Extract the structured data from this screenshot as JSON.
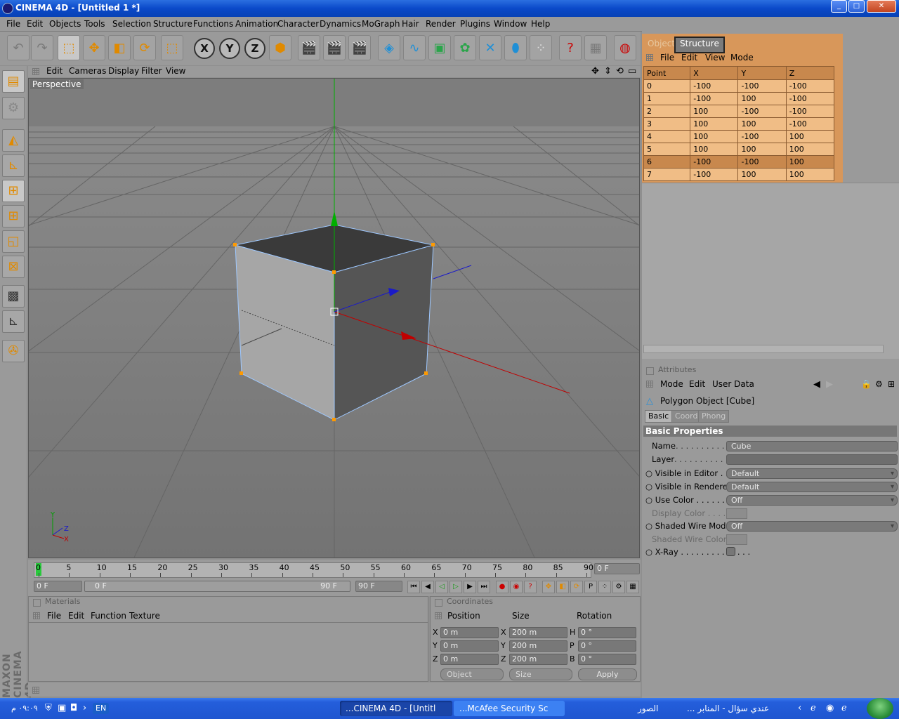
{
  "window": {
    "title": "CINEMA 4D - [Untitled 1 *]",
    "min_glyph": "_",
    "max_glyph": "□",
    "close_glyph": "✕"
  },
  "menubar": [
    "File",
    "Edit",
    "Objects",
    "Tools",
    "Selection",
    "Structure",
    "Functions",
    "Animation",
    "Character",
    "Dynamics",
    "MoGraph",
    "Hair",
    "Render",
    "Plugins",
    "Window",
    "Help"
  ],
  "toolbar_icons": [
    "undo-icon",
    "redo-icon",
    "live-selection-icon",
    "move-icon",
    "scale-icon",
    "rotate-icon",
    "selection-tool-icon",
    "x-axis-icon",
    "y-axis-icon",
    "z-axis-icon",
    "world-coordinates-icon",
    "render-view-icon",
    "render-picture-viewer-icon",
    "render-settings-icon",
    "cube-icon",
    "spline-icon",
    "nurbs-icon",
    "modeling-icon",
    "deformer-icon",
    "scene-icon",
    "particles-icon",
    "help-icon",
    "layout-icon",
    "web-icon"
  ],
  "xyz": {
    "x": "X",
    "y": "Y",
    "z": "Z"
  },
  "viewport": {
    "menu": [
      "Edit",
      "Cameras",
      "Display",
      "Filter",
      "View"
    ],
    "label": "Perspective"
  },
  "timeline": {
    "ticks": [
      "0",
      "5",
      "10",
      "15",
      "20",
      "25",
      "30",
      "35",
      "40",
      "45",
      "50",
      "55",
      "60",
      "65",
      "70",
      "75",
      "80",
      "85",
      "90"
    ],
    "current_frame": "0 F",
    "start_frame": "0 F",
    "range_start": "0 F",
    "range_end": "90 F",
    "end_frame": "90 F"
  },
  "materials": {
    "title": "Materials",
    "menu": [
      "File",
      "Edit",
      "Function",
      "Texture"
    ]
  },
  "coordinates": {
    "title": "Coordinates",
    "headers": [
      "Position",
      "Size",
      "Rotation"
    ],
    "rows": [
      {
        "axis": "X",
        "pos": "0 m",
        "size_axis": "X",
        "size": "200 m",
        "rot_axis": "H",
        "rot": "0 °"
      },
      {
        "axis": "Y",
        "pos": "0 m",
        "size_axis": "Y",
        "size": "200 m",
        "rot_axis": "P",
        "rot": "0 °"
      },
      {
        "axis": "Z",
        "pos": "0 m",
        "size_axis": "Z",
        "size": "200 m",
        "rot_axis": "B",
        "rot": "0 °"
      }
    ],
    "mode_dropdown": "Object",
    "size_dropdown": "Size",
    "apply": "Apply"
  },
  "structure": {
    "tabs": [
      "Objects",
      "Structure"
    ],
    "menu": [
      "File",
      "Edit",
      "View",
      "Mode"
    ],
    "columns": [
      "Point",
      "X",
      "Y",
      "Z"
    ],
    "points": [
      [
        "0",
        "-100",
        "-100",
        "-100"
      ],
      [
        "1",
        "-100",
        "100",
        "-100"
      ],
      [
        "2",
        "100",
        "-100",
        "-100"
      ],
      [
        "3",
        "100",
        "100",
        "-100"
      ],
      [
        "4",
        "100",
        "-100",
        "100"
      ],
      [
        "5",
        "100",
        "100",
        "100"
      ],
      [
        "6",
        "-100",
        "-100",
        "100"
      ],
      [
        "7",
        "-100",
        "100",
        "100"
      ]
    ],
    "selected_row": 6
  },
  "attributes": {
    "title": "Attributes",
    "menu": [
      "Mode",
      "Edit",
      "User Data"
    ],
    "object_title": "Polygon Object [Cube]",
    "tabs": [
      "Basic",
      "Coord.",
      "Phong"
    ],
    "section": "Basic Properties",
    "name_label": "Name",
    "name_value": "Cube",
    "layer_label": "Layer",
    "visible_editor_label": "Visible in Editor",
    "visible_editor_value": "Default",
    "visible_renderer_label": "Visible in Renderer",
    "visible_renderer_value": "Default",
    "use_color_label": "Use Color",
    "use_color_value": "Off",
    "display_color_label": "Display Color",
    "shaded_wire_mode_label": "Shaded Wire Mode",
    "shaded_wire_mode_value": "Off",
    "shaded_wire_color_label": "Shaded Wire Color",
    "xray_label": "X-Ray"
  },
  "branding": "MAXON CINEMA 4D",
  "taskbar": {
    "clock": "٠٩:٠٩ م",
    "lang": "EN",
    "task_c4d": "...CINEMA 4D - [Untitl",
    "task_mcafee": "...McAfee Security Sc",
    "task_photos": "الصور",
    "task_ie": "... عندي سؤال - المنابر"
  },
  "colors": {
    "accent_orange": "#e08a00",
    "structure_bg": "#d8975a",
    "x_axis": "#c00000",
    "y_axis": "#00a000",
    "z_axis": "#1a1ac8"
  }
}
